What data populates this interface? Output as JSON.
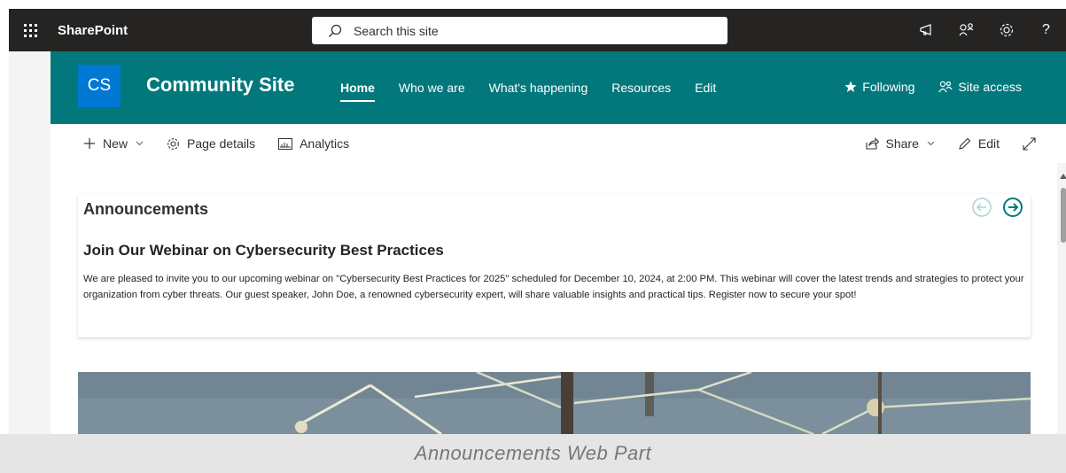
{
  "suite_bar": {
    "app_name": "SharePoint",
    "search_placeholder": "Search this site",
    "icons": [
      "waffle-icon",
      "megaphone-icon",
      "share-icon",
      "gear-icon",
      "help-icon"
    ],
    "help_label": "?"
  },
  "site_header": {
    "logo_text": "CS",
    "title": "Community Site",
    "nav": [
      {
        "label": "Home",
        "active": true
      },
      {
        "label": "Who we are"
      },
      {
        "label": "What's happening"
      },
      {
        "label": "Resources"
      },
      {
        "label": "Edit"
      }
    ],
    "actions": {
      "following": "Following",
      "site_access": "Site access"
    },
    "color": "#03787c",
    "logo_color": "#0078d4"
  },
  "command_bar": {
    "new": "New",
    "page_details": "Page details",
    "analytics": "Analytics",
    "share": "Share",
    "edit": "Edit"
  },
  "announcements": {
    "title": "Announcements",
    "heading": "Join Our Webinar on Cybersecurity Best Practices",
    "body": "We are pleased to invite you to our upcoming webinar on \"Cybersecurity Best Practices for 2025\" scheduled for December 10, 2024, at 2:00 PM. This webinar will cover the latest trends and strategies to protect your organization from cyber threats. Our guest speaker, John Doe, a renowned cybersecurity expert, will share valuable insights and practical tips. Register now to secure your spot!"
  },
  "caption": "Announcements Web Part"
}
